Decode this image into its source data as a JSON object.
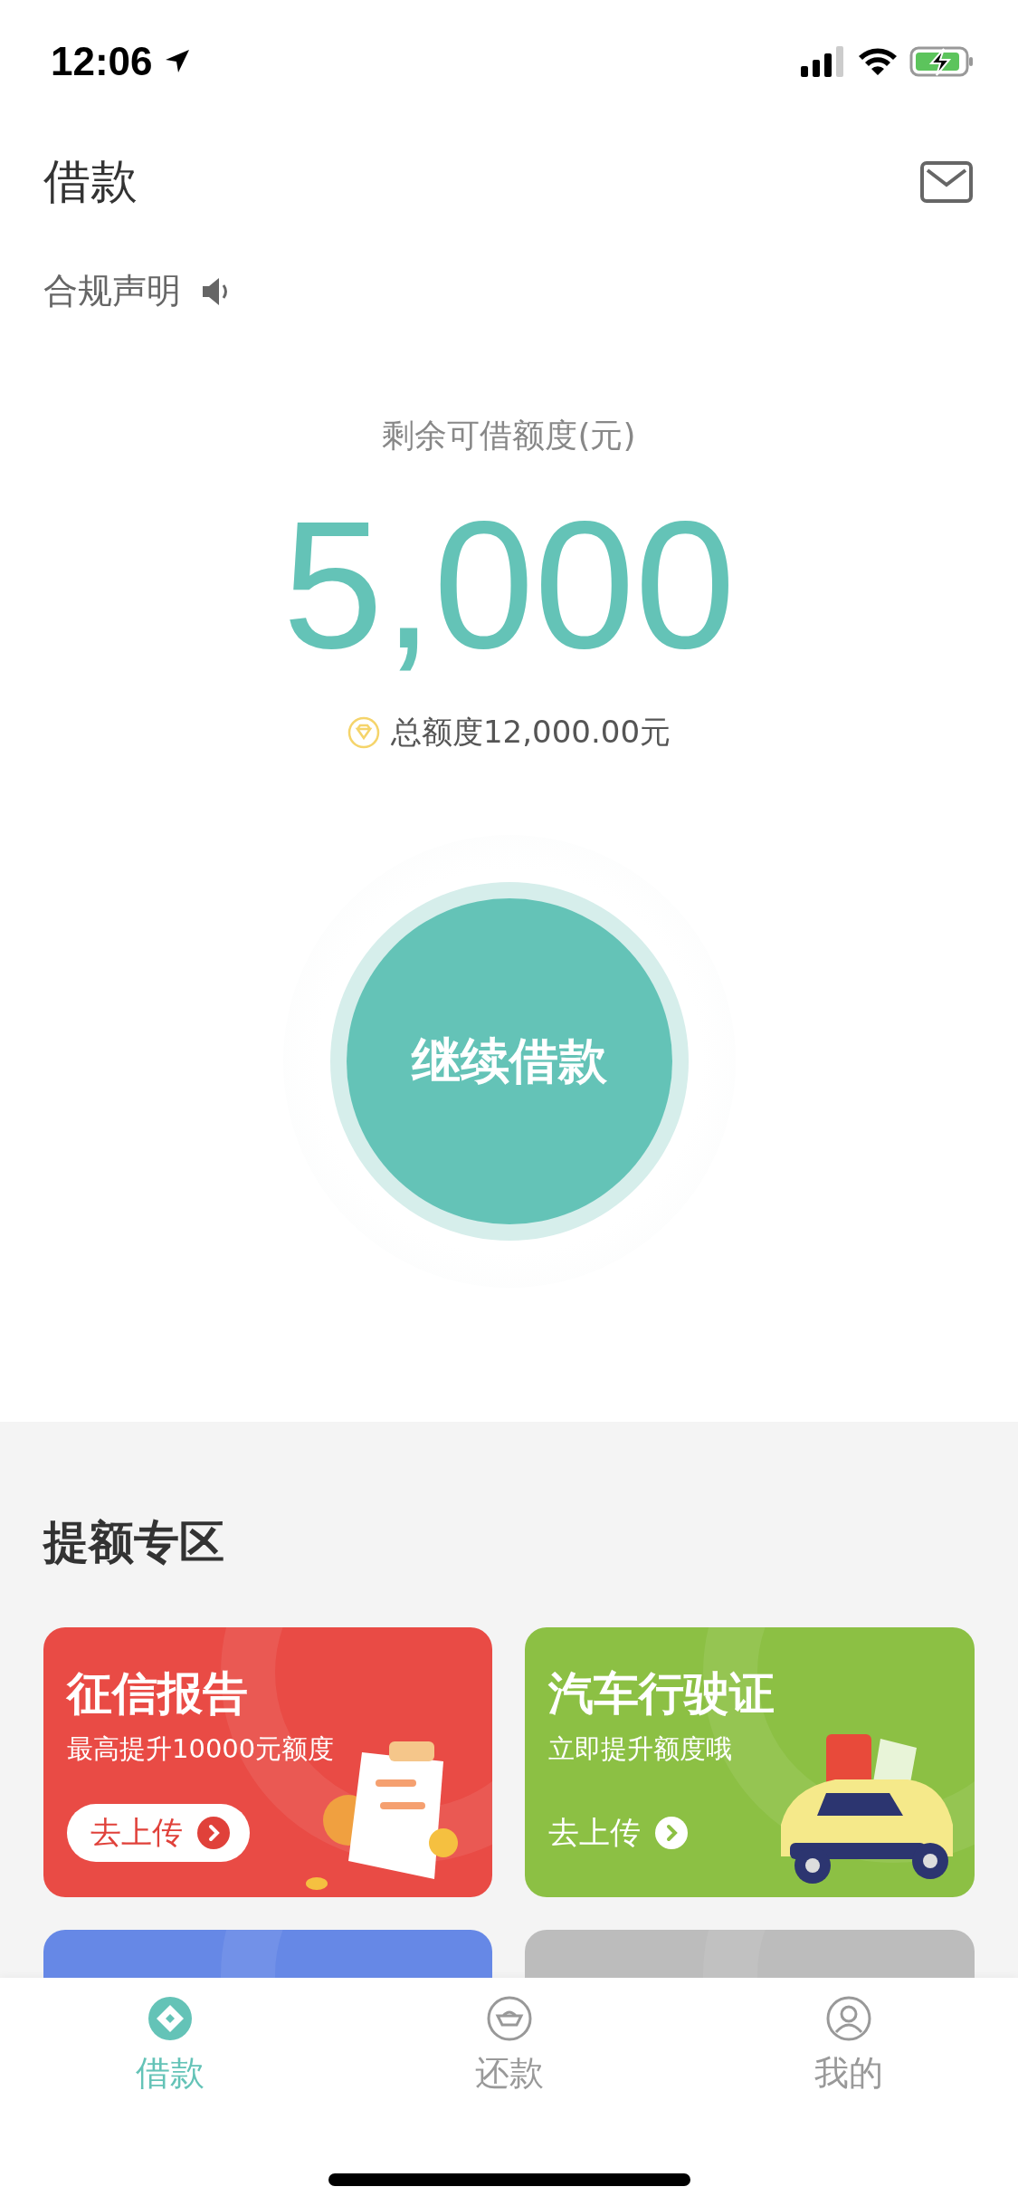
{
  "status_bar": {
    "time": "12:06"
  },
  "header": {
    "title": "借款"
  },
  "notice": {
    "label": "合规声明"
  },
  "credit": {
    "label": "剩余可借额度(元)",
    "amount": "5,000",
    "total": "总额度12,000.00元"
  },
  "action_button": {
    "label": "继续借款"
  },
  "boost_section": {
    "title": "提额专区",
    "cards": [
      {
        "kind": "report",
        "title": "征信报告",
        "subtitle": "最高提升10000元额度",
        "button": "去上传",
        "color": "#e94b45"
      },
      {
        "kind": "car",
        "title": "汽车行驶证",
        "subtitle": "立即提升额度哦",
        "button": "去上传",
        "color": "#8cc044"
      },
      {
        "kind": "partial",
        "color": "#6688e6"
      },
      {
        "kind": "partial",
        "color": "#bcbcbc"
      }
    ]
  },
  "tab_bar": {
    "tabs": [
      {
        "kind": "borrow",
        "label": "借款",
        "selected": true
      },
      {
        "kind": "repay",
        "label": "还款",
        "selected": false
      },
      {
        "kind": "profile",
        "label": "我的",
        "selected": false
      }
    ]
  }
}
